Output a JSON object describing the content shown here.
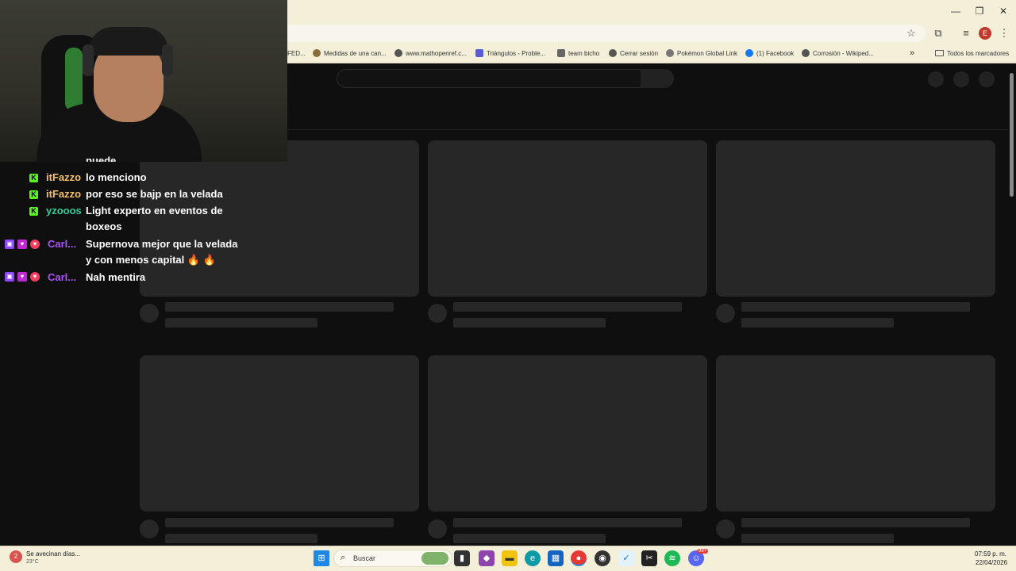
{
  "window": {
    "minimize_glyph": "—",
    "restore_glyph": "❐",
    "close_glyph": "✕"
  },
  "toolbar": {
    "star_icon": "☆",
    "extensions_icon": "⧉",
    "media_icon": "≡",
    "profile_initial": "E",
    "menu_icon": "⋮"
  },
  "bookmarks": {
    "items": [
      {
        "label": "FED...",
        "icon": "folder-icon"
      },
      {
        "label": "Medidas de una can...",
        "icon": "site-icon"
      },
      {
        "label": "www.mathopenref.c...",
        "icon": "globe-icon"
      },
      {
        "label": "Triángulos - Proble...",
        "icon": "site-icon"
      },
      {
        "label": "team bicho",
        "icon": "site-icon"
      },
      {
        "label": "Cerrar sesión",
        "icon": "globe-icon"
      },
      {
        "label": "Pokémon Global Link",
        "icon": "pokeball-icon"
      },
      {
        "label": "(1) Facebook",
        "icon": "facebook-icon"
      },
      {
        "label": "Corrosión - Wikiped...",
        "icon": "globe-icon"
      }
    ],
    "overflow_glyph": "»",
    "all_bookmarks_label": "Todos los marcadores"
  },
  "chat": {
    "messages": [
      {
        "user": "",
        "text": "puede",
        "badges": [],
        "color": "#ffffff"
      },
      {
        "user": "itFazzo",
        "text": "lo menciono",
        "badges": [
          "kick"
        ],
        "color": "#f5c16c"
      },
      {
        "user": "itFazzo",
        "text": "por eso se bajp en la velada",
        "badges": [
          "kick"
        ],
        "color": "#f5c16c"
      },
      {
        "user": "yzooos",
        "text": "Light experto en eventos de",
        "text2": "boxeos",
        "badges": [
          "kick"
        ],
        "color": "#2ecc9a"
      },
      {
        "user": "Carl...",
        "text": "Supernova mejor que la velada",
        "text2": "y con menos capital 🔥 🔥",
        "badges": [
          "twitch",
          "sub",
          "heart"
        ],
        "color": "#a855f7"
      },
      {
        "user": "Carl...",
        "text": "Nah mentira",
        "badges": [
          "twitch",
          "sub",
          "heart"
        ],
        "color": "#a855f7"
      }
    ]
  },
  "taskbar": {
    "weather_text": "Se avecinan días...",
    "weather_temp": "23°C",
    "weather_badge": "2",
    "search_label": "Buscar",
    "time": "07:59 p. m.",
    "date": "22/04/2026",
    "notification_count": "99+"
  }
}
